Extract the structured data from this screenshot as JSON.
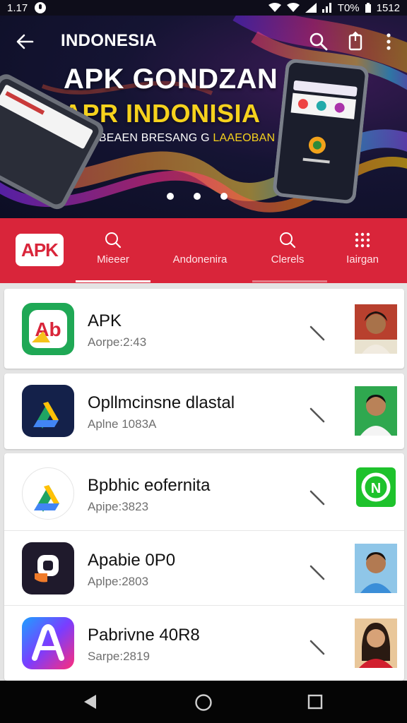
{
  "status_bar": {
    "time": "1.17",
    "battery": "T0%",
    "clock": "1512"
  },
  "header": {
    "title": "INDONESIA",
    "headline_1": "APK GONDZAN",
    "headline_2": "APR INDONISIA",
    "headline_3_main": "PHOOBEAEN BRESANG G ",
    "headline_3_accent": "LAAEOBAN",
    "carousel_pages": 3
  },
  "tabs": {
    "logo": "APK",
    "items": [
      {
        "label": "Mieeer",
        "icon": "search-icon"
      },
      {
        "label": "Andonenira",
        "icon": "none"
      },
      {
        "label": "Clerels",
        "icon": "search-icon"
      },
      {
        "label": "Iairgan",
        "icon": "grid-icon"
      }
    ]
  },
  "apps": [
    {
      "name": "APK",
      "subtitle": "Aorpe:2:43",
      "icon": "apk-red-icon",
      "thumb": "person-photo"
    },
    {
      "name": "Opllmcinsne dlastal",
      "subtitle": "Aplne 1083A",
      "icon": "drive-dark-icon",
      "thumb": "person-photo"
    },
    {
      "name": "Bpbhic eofernita",
      "subtitle": "Apipe:3823",
      "icon": "drive-white-icon",
      "thumb": "green-logo"
    },
    {
      "name": "Apabie 0P0",
      "subtitle": "Aplpe:2803",
      "icon": "dark-orange-icon",
      "thumb": "person-photo"
    },
    {
      "name": "Pabrivne 40R8",
      "subtitle": "Sarpe:2819",
      "icon": "gradient-a-icon",
      "thumb": "person-photo"
    }
  ],
  "colors": {
    "accent": "#d9253a",
    "headline_yellow": "#f6d21d",
    "hero_bg": "#151433"
  }
}
